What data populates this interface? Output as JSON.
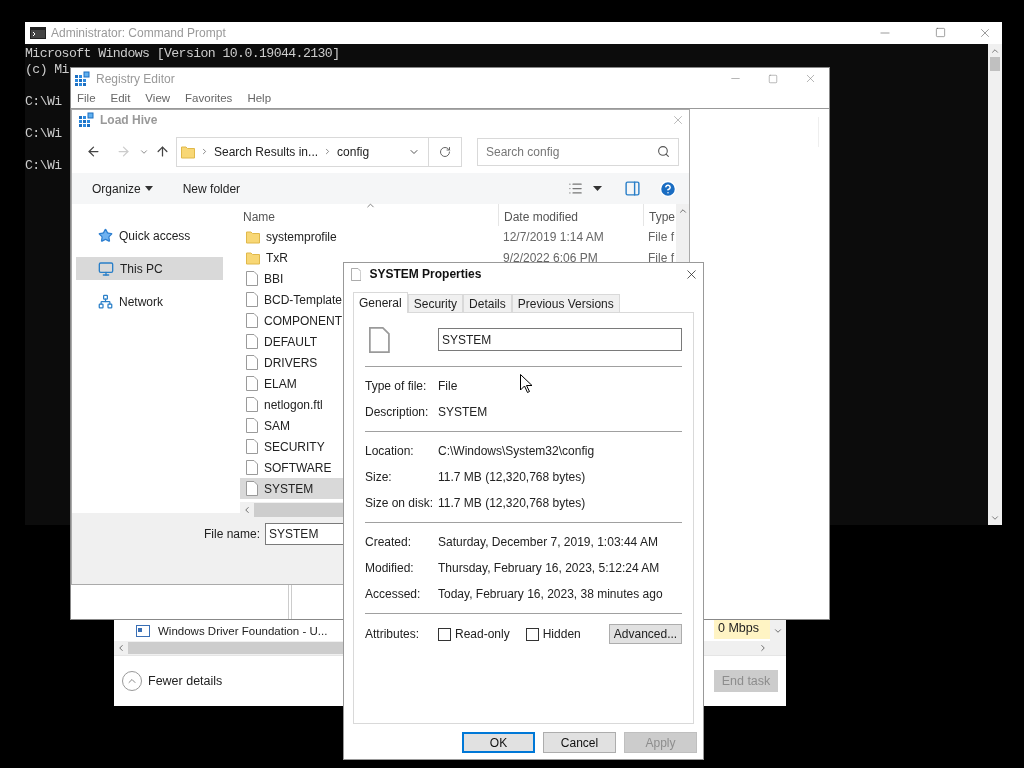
{
  "cmd": {
    "title": "Administrator:  Command Prompt",
    "lines": [
      "Microsoft Windows [Version 10.0.19044.2130]",
      "(c) Mi",
      "C:\\Wi",
      "C:\\Wi",
      "C:\\Wi"
    ]
  },
  "task_manager": {
    "row": {
      "name": "Windows Driver Foundation - U...",
      "network": "0 Mbps"
    },
    "fewer_details": "Fewer details",
    "end_task": {
      "label": "End task",
      "disabled": true
    }
  },
  "registry_editor": {
    "title": "Registry Editor",
    "menu": [
      "File",
      "Edit",
      "View",
      "Favorites",
      "Help"
    ]
  },
  "load_hive": {
    "title": "Load Hive",
    "breadcrumb": [
      "Search Results in...",
      "config"
    ],
    "search_placeholder": "Search config",
    "organize": "Organize",
    "new_folder": "New folder",
    "nav": [
      {
        "label": "Quick access",
        "kind": "star",
        "selected": false
      },
      {
        "label": "This PC",
        "kind": "pc",
        "selected": true
      },
      {
        "label": "Network",
        "kind": "network",
        "selected": false
      }
    ],
    "columns": [
      "Name",
      "Date modified",
      "Type"
    ],
    "files": [
      {
        "name": "systemprofile",
        "kind": "folder",
        "date": "12/7/2019 1:14 AM",
        "type": "File f",
        "selected": false
      },
      {
        "name": "TxR",
        "kind": "folder",
        "date": "9/2/2022 6:06 PM",
        "type": "File f",
        "selected": false
      },
      {
        "name": "BBI",
        "kind": "file",
        "selected": false
      },
      {
        "name": "BCD-Template",
        "kind": "file",
        "selected": false
      },
      {
        "name": "COMPONENT",
        "kind": "file",
        "selected": false
      },
      {
        "name": "DEFAULT",
        "kind": "file",
        "selected": false
      },
      {
        "name": "DRIVERS",
        "kind": "file",
        "selected": false
      },
      {
        "name": "ELAM",
        "kind": "file",
        "selected": false
      },
      {
        "name": "netlogon.ftl",
        "kind": "file",
        "selected": false
      },
      {
        "name": "SAM",
        "kind": "file",
        "selected": false
      },
      {
        "name": "SECURITY",
        "kind": "file",
        "selected": false
      },
      {
        "name": "SOFTWARE",
        "kind": "file",
        "selected": false
      },
      {
        "name": "SYSTEM",
        "kind": "file",
        "selected": true
      }
    ],
    "file_name_label": "File name:",
    "file_name": "SYSTEM"
  },
  "properties": {
    "title": "SYSTEM Properties",
    "tabs": [
      {
        "label": "General",
        "selected": true
      },
      {
        "label": "Security",
        "selected": false
      },
      {
        "label": "Details",
        "selected": false
      },
      {
        "label": "Previous Versions",
        "selected": false
      }
    ],
    "name": "SYSTEM",
    "groups": [
      [
        {
          "label": "Type of file:",
          "value": "File"
        },
        {
          "label": "Description:",
          "value": "SYSTEM"
        }
      ],
      [
        {
          "label": "Location:",
          "value": "C:\\Windows\\System32\\config"
        },
        {
          "label": "Size:",
          "value": "11.7 MB (12,320,768 bytes)"
        },
        {
          "label": "Size on disk:",
          "value": "11.7 MB (12,320,768 bytes)"
        }
      ],
      [
        {
          "label": "Created:",
          "value": "Saturday, December 7, 2019, 1:03:44 AM"
        },
        {
          "label": "Modified:",
          "value": "Thursday, February 16, 2023, 5:12:24 AM"
        },
        {
          "label": "Accessed:",
          "value": "Today, February 16, 2023, 38 minutes ago"
        }
      ]
    ],
    "attributes_label": "Attributes:",
    "checkboxes": [
      {
        "label": "Read-only",
        "checked": false
      },
      {
        "label": "Hidden",
        "checked": false
      }
    ],
    "advanced": "Advanced...",
    "buttons": [
      {
        "label": "OK",
        "default": true,
        "disabled": false
      },
      {
        "label": "Cancel",
        "default": false,
        "disabled": false
      },
      {
        "label": "Apply",
        "default": false,
        "disabled": true
      }
    ]
  }
}
